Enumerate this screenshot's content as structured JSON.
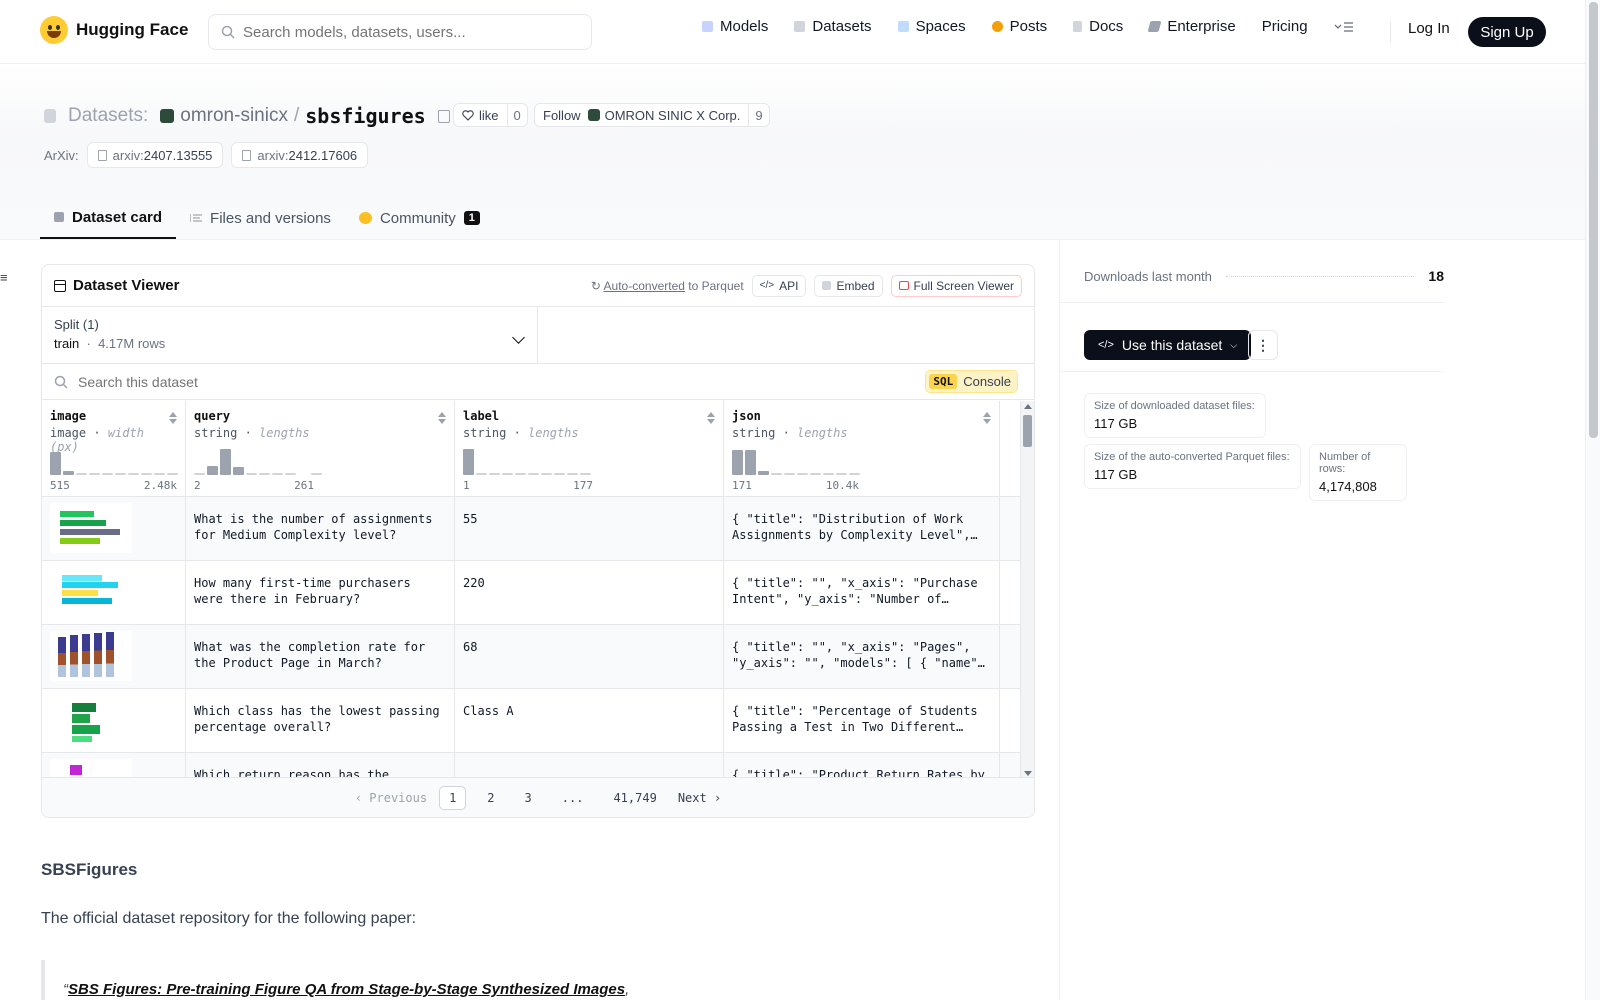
{
  "header": {
    "brand": "Hugging Face",
    "search_placeholder": "Search models, datasets, users...",
    "nav": [
      {
        "label": "Models",
        "icon": "models-icon",
        "color": "#c7d2fe"
      },
      {
        "label": "Datasets",
        "icon": "datasets-icon",
        "color": "#d1d5db"
      },
      {
        "label": "Spaces",
        "icon": "spaces-icon",
        "color": "#bfdbfe"
      },
      {
        "label": "Posts",
        "icon": "posts-icon",
        "color": "#f59e0b"
      },
      {
        "label": "Docs",
        "icon": "docs-icon",
        "color": "#d1d5db"
      },
      {
        "label": "Enterprise",
        "icon": "enterprise-icon",
        "color": "#9ca3af"
      },
      {
        "label": "Pricing"
      }
    ],
    "login": "Log In",
    "signup": "Sign Up"
  },
  "repo": {
    "type_label": "Datasets:",
    "org": "omron-sinicx",
    "name": "sbsfigures",
    "like_label": "like",
    "like_count": "0",
    "follow_label": "Follow",
    "follow_org": "OMRON SINIC X Corp.",
    "follow_count": "9",
    "arxiv_label": "ArXiv:",
    "arxiv": [
      {
        "prefix": "arxiv:",
        "id": "2407.13555"
      },
      {
        "prefix": "arxiv:",
        "id": "2412.17606"
      }
    ]
  },
  "tabs": [
    {
      "label": "Dataset card",
      "active": true
    },
    {
      "label": "Files and versions"
    },
    {
      "label": "Community",
      "badge": "1"
    }
  ],
  "viewer": {
    "title": "Dataset Viewer",
    "auto_converted": "Auto-converted",
    "to_parquet": "to Parquet",
    "api": "API",
    "embed": "Embed",
    "full_screen": "Full Screen Viewer",
    "split_label": "Split (1)",
    "split_name": "train",
    "split_rows": "4.17M rows",
    "search_placeholder": "Search this dataset",
    "sql": "SQL",
    "console": "Console",
    "columns": [
      {
        "name": "image",
        "type": "image",
        "stat": "width (px)",
        "min": "515",
        "max": "2.48k",
        "hist": [
          0.9,
          0.15,
          0.05,
          0.05,
          0.05,
          0.05,
          0.05,
          0.05,
          0.05,
          0.05
        ]
      },
      {
        "name": "query",
        "type": "string",
        "stat": "lengths",
        "min": "2",
        "max": "261",
        "hist": [
          0.05,
          0.35,
          1.0,
          0.3,
          0.05,
          0.05,
          0.05,
          0.05,
          0.0,
          0.05
        ]
      },
      {
        "name": "label",
        "type": "string",
        "stat": "lengths",
        "min": "1",
        "max": "177",
        "hist": [
          1.0,
          0.05,
          0.05,
          0.05,
          0.05,
          0.05,
          0.05,
          0.05,
          0.05,
          0.05
        ]
      },
      {
        "name": "json",
        "type": "string",
        "stat": "lengths",
        "min": "171",
        "max": "10.4k",
        "hist": [
          0.95,
          0.95,
          0.15,
          0.05,
          0.05,
          0.05,
          0.05,
          0.05,
          0.05,
          0.05
        ]
      }
    ],
    "rows": [
      {
        "query": "What is the number of assignments for Medium Complexity level?",
        "label": "55",
        "json": "{ \"title\": \"Distribution of Work Assignments by Complexity Level\", \"x_axis\": ..."
      },
      {
        "query": "How many first-time purchasers were there in February?",
        "label": "220",
        "json": "{ \"title\": \"\", \"x_axis\": \"Purchase Intent\", \"y_axis\": \"Number of Customers\" ..."
      },
      {
        "query": "What was the completion rate for the Product Page in March?",
        "label": "68",
        "json": "{ \"title\": \"\", \"x_axis\": \"Pages\", \"y_axis\": \"\", \"models\": [ { \"name\": ..."
      },
      {
        "query": "Which class has the lowest passing percentage overall?",
        "label": "Class A",
        "json": "{ \"title\": \"Percentage of Students Passing a Test in Two Different Classes\" ..."
      },
      {
        "query": "Which return reason has the highest",
        "label": "",
        "json": "{ \"title\": \"Product Return Rates by"
      }
    ],
    "pager": {
      "prev": "Previous",
      "pages": [
        "1",
        "2",
        "3",
        "...",
        "41,749"
      ],
      "next": "Next"
    }
  },
  "card": {
    "heading": "SBSFigures",
    "intro": "The official dataset repository for the following paper:",
    "quote_open": "“",
    "quote_link": "SBS Figures: Pre-training Figure QA from Stage-by-Stage Synthesized Images",
    "quote_rest": ","
  },
  "sidebar": {
    "downloads_label": "Downloads last month",
    "downloads_value": "18",
    "use_button": "Use this dataset",
    "stats": [
      {
        "label": "Size of downloaded dataset files:",
        "value": "117 GB"
      },
      {
        "label": "Size of the auto-converted Parquet files:",
        "value": "117 GB"
      },
      {
        "label": "Number of rows:",
        "value": "4,174,808"
      }
    ]
  }
}
